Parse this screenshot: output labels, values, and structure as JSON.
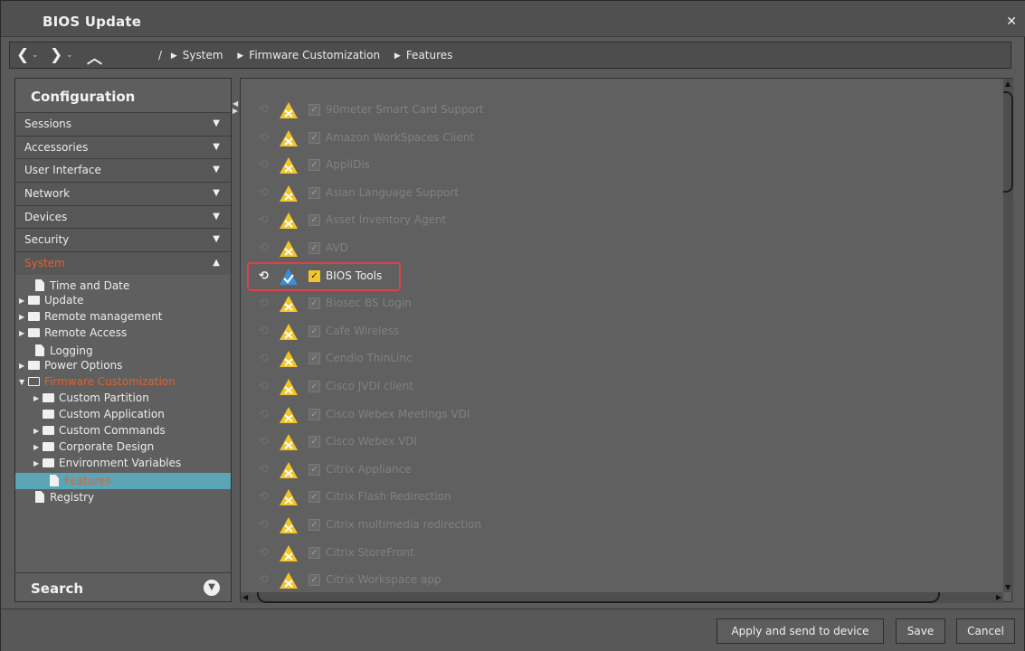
{
  "window": {
    "title": "BIOS Update",
    "close_icon": "close-icon"
  },
  "nav": {
    "back_icon": "chevron-left-icon",
    "forward_icon": "chevron-right-icon",
    "up_icon": "chevron-up-icon",
    "root": "/",
    "breadcrumbs": [
      "System",
      "Firmware Customization",
      "Features"
    ]
  },
  "sidebar": {
    "title": "Configuration",
    "categories": [
      "Sessions",
      "Accessories",
      "User Interface",
      "Network",
      "Devices",
      "Security",
      "System"
    ],
    "active_category": "System",
    "tree": [
      {
        "label": "Time and Date",
        "type": "doc"
      },
      {
        "label": "Update",
        "type": "folder"
      },
      {
        "label": "Remote management",
        "type": "folder"
      },
      {
        "label": "Remote Access",
        "type": "folder"
      },
      {
        "label": "Logging",
        "type": "doc"
      },
      {
        "label": "Power Options",
        "type": "folder"
      },
      {
        "label": "Firmware Customization",
        "type": "folder-open"
      },
      {
        "label": "Custom Partition",
        "type": "folder"
      },
      {
        "label": "Custom Application",
        "type": "folder"
      },
      {
        "label": "Custom Commands",
        "type": "folder"
      },
      {
        "label": "Corporate Design",
        "type": "folder"
      },
      {
        "label": "Environment Variables",
        "type": "folder"
      },
      {
        "label": "Features",
        "type": "doc"
      },
      {
        "label": "Registry",
        "type": "doc"
      }
    ],
    "selected": "Features",
    "search_label": "Search"
  },
  "features": [
    {
      "label": "90meter Smart Card Support",
      "enabled": false
    },
    {
      "label": "Amazon WorkSpaces Client",
      "enabled": false
    },
    {
      "label": "AppliDis",
      "enabled": false
    },
    {
      "label": "Asian Language Support",
      "enabled": false
    },
    {
      "label": "Asset Inventory Agent",
      "enabled": false
    },
    {
      "label": "AVD",
      "enabled": false
    },
    {
      "label": "BIOS Tools",
      "enabled": true
    },
    {
      "label": "Biosec BS Login",
      "enabled": false
    },
    {
      "label": "Cafe Wireless",
      "enabled": false
    },
    {
      "label": "Cendio ThinLinc",
      "enabled": false
    },
    {
      "label": "Cisco JVDI client",
      "enabled": false
    },
    {
      "label": "Cisco Webex Meetings VDI",
      "enabled": false
    },
    {
      "label": "Cisco Webex VDI",
      "enabled": false
    },
    {
      "label": "Citrix Appliance",
      "enabled": false
    },
    {
      "label": "Citrix Flash Redirection",
      "enabled": false
    },
    {
      "label": "Citrix multimedia redirection",
      "enabled": false
    },
    {
      "label": "Citrix StoreFront",
      "enabled": false
    },
    {
      "label": "Citrix Workspace app",
      "enabled": false
    }
  ],
  "buttons": {
    "apply": "Apply and send to device",
    "save": "Save",
    "cancel": "Cancel"
  },
  "colors": {
    "accent": "#e2612c",
    "selection": "#5aa6b8",
    "warning": "#f2c52a",
    "highlight": "#e0404a",
    "ok": "#3a8fd8"
  }
}
